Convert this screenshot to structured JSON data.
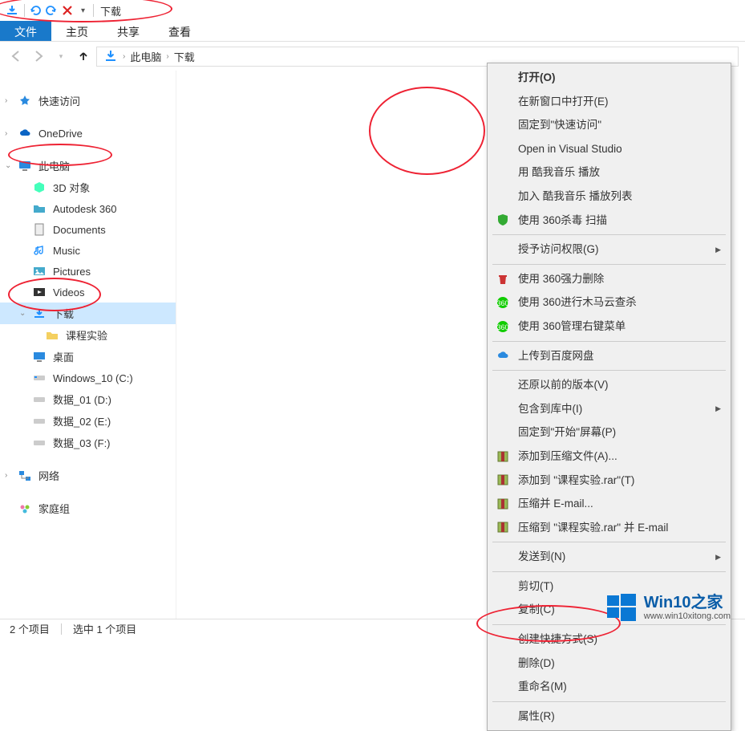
{
  "window_title": "下载",
  "ribbon": {
    "file": "文件",
    "home": "主页",
    "share": "共享",
    "view": "查看"
  },
  "breadcrumb": {
    "pc": "此电脑",
    "downloads": "下载"
  },
  "sidebar": {
    "quick": "快速访问",
    "onedrive": "OneDrive",
    "thispc": "此电脑",
    "items": [
      "3D 对象",
      "Autodesk 360",
      "Documents",
      "Music",
      "Pictures",
      "Videos",
      "下载",
      "桌面",
      "Windows_10 (C:)",
      "数据_01 (D:)",
      "数据_02 (E:)",
      "数据_03 (F:)"
    ],
    "downloads_child": "课程实验",
    "network": "网络",
    "homegroup": "家庭组"
  },
  "file": {
    "name": "课程实验"
  },
  "context_menu": {
    "open": "打开(O)",
    "open_new": "在新窗口中打开(E)",
    "pin_quick": "固定到\"快速访问\"",
    "open_vs": "Open in Visual Studio",
    "kuwo_play": "用 酷我音乐 播放",
    "kuwo_add": "加入 酷我音乐 播放列表",
    "scan_360": "使用 360杀毒 扫描",
    "grant_access": "授予访问权限(G)",
    "force_del_360": "使用 360强力删除",
    "trojan_360": "使用 360进行木马云查杀",
    "manage_360": "使用 360管理右键菜单",
    "baidu_upload": "上传到百度网盘",
    "restore": "还原以前的版本(V)",
    "include_lib": "包含到库中(I)",
    "pin_start": "固定到\"开始\"屏幕(P)",
    "addto_archive": "添加到压缩文件(A)...",
    "addto_rar": "添加到 \"课程实验.rar\"(T)",
    "archive_email": "压缩并 E-mail...",
    "archive_rar_email": "压缩到 \"课程实验.rar\" 并 E-mail",
    "sendto": "发送到(N)",
    "cut": "剪切(T)",
    "copy": "复制(C)",
    "shortcut": "创建快捷方式(S)",
    "del": "删除(D)",
    "rename": "重命名(M)",
    "props": "属性(R)"
  },
  "status": {
    "count": "2 个项目",
    "selected": "选中 1 个项目"
  },
  "watermark": {
    "brand": "Win10之家",
    "url": "www.win10xitong.com"
  }
}
